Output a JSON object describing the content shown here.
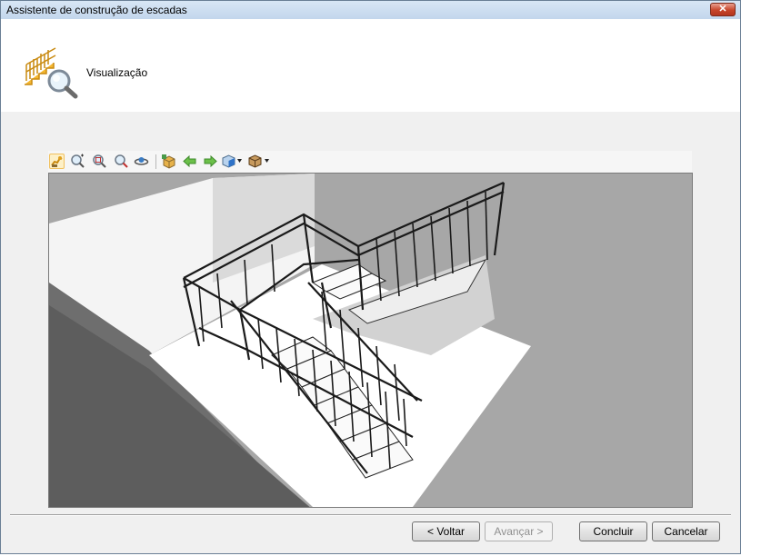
{
  "window": {
    "title": "Assistente de construção de escadas",
    "close_glyph": "✕"
  },
  "header": {
    "step_title": "Visualização",
    "icon": "stairs-zoom-icon"
  },
  "toolbar": {
    "tools": [
      "camera-pan-icon",
      "zoom-extents-icon",
      "zoom-window-icon",
      "zoom-icon",
      "orbit-icon",
      "view-cube-icon",
      "previous-view-icon",
      "next-view-icon",
      "shading-mode-icon",
      "render-style-icon"
    ]
  },
  "buttons": {
    "back": "< Voltar",
    "next": "Avançar >",
    "finish": "Concluir",
    "cancel": "Cancelar"
  },
  "colors": {
    "titlebar": "#c2d6ec",
    "close": "#c7452a",
    "dialog_bg": "#f0f0f0",
    "viewport_bg": "#a8a8a8"
  }
}
